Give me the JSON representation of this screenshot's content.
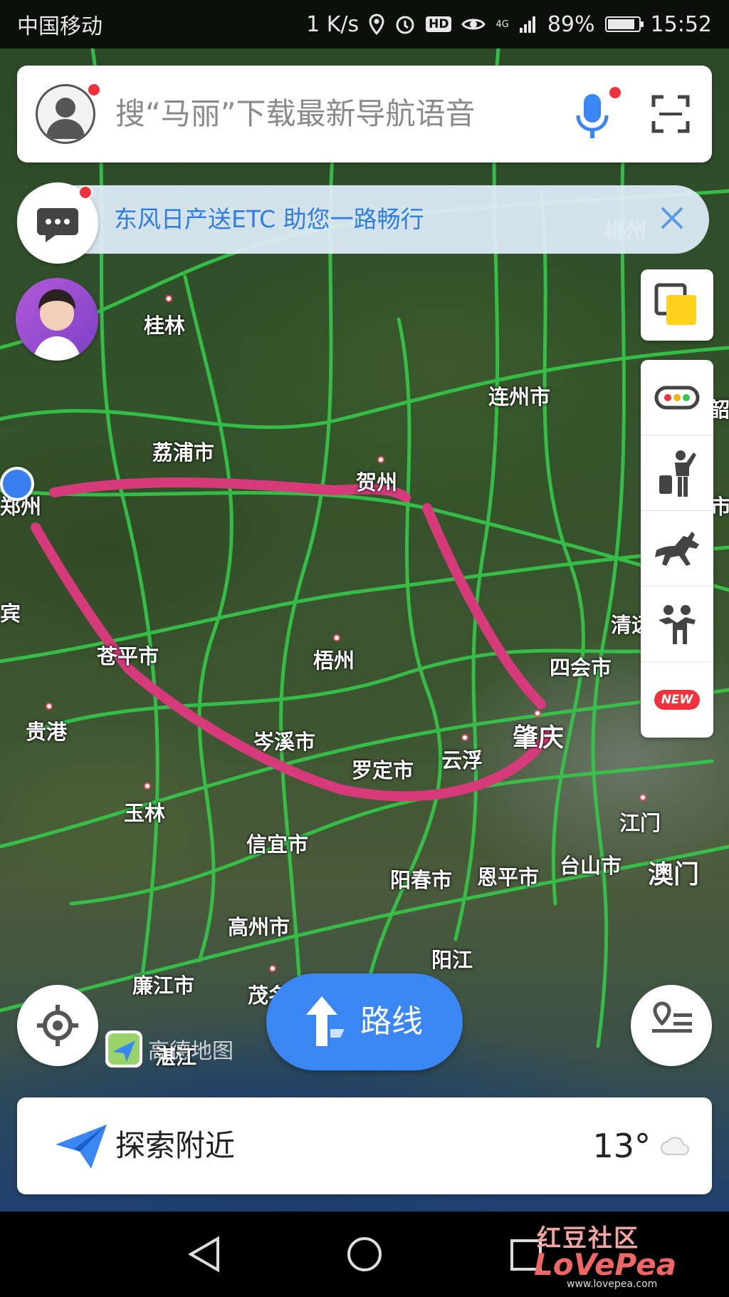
{
  "status_bar": {
    "carrier": "中国移动",
    "speed": "1 K/s",
    "hd": "HD",
    "network": "4G",
    "battery": "89%",
    "battery_level": 0.89,
    "time": "15:52",
    "icons": [
      "location-icon",
      "alarm-icon",
      "eye-icon",
      "signal-icon",
      "battery-icon"
    ]
  },
  "search": {
    "placeholder": "搜“马丽”下载最新导航语音"
  },
  "banner": {
    "text": "东风日产送ETC 助您一路畅行"
  },
  "map": {
    "cities": [
      "桂林",
      "郴州",
      "连州市",
      "荔浦市",
      "贺州",
      "郑州",
      "清远",
      "梧州",
      "四会市",
      "苍平市",
      "贵港",
      "岑溪市",
      "肇庆",
      "罗定市",
      "云浮",
      "玉林",
      "江门",
      "信宜市",
      "阳春市",
      "恩平市",
      "台山市",
      "澳门",
      "高州市",
      "阳江",
      "廉江市",
      "茂名",
      "湛江",
      "宾",
      "韶",
      "市"
    ],
    "route_color": "#d63a7a",
    "road_color": "#35c94a"
  },
  "toolbar": {
    "layers": "layers-icon",
    "tools": [
      "traffic-icon",
      "taxi-icon",
      "horse-icon",
      "people-icon"
    ],
    "new_badge": "NEW"
  },
  "route_button": {
    "label": "路线"
  },
  "logo": {
    "text": "高德地图"
  },
  "nearby": {
    "label": "探索附近",
    "temperature": "13°",
    "weather_icon": "cloud-icon"
  },
  "watermark": {
    "top": "红豆社区",
    "brand": "LoVePea",
    "url": "www.lovepea.com"
  }
}
